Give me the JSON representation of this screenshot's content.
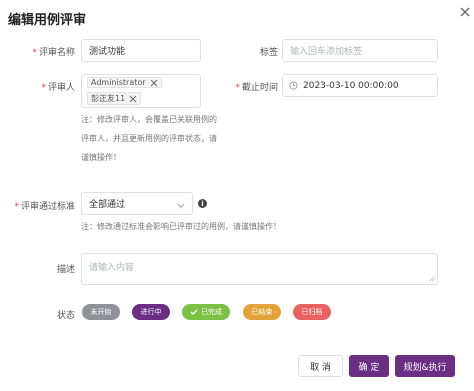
{
  "dialog": {
    "title": "编辑用例评审"
  },
  "form": {
    "name": {
      "label": "评审名称",
      "value": "测试功能"
    },
    "tags": {
      "label": "标签",
      "placeholder": "输入回车添加标签"
    },
    "reviewers": {
      "label": "评审人",
      "selected": [
        "Administrator",
        "彭正友11"
      ]
    },
    "deadline": {
      "label": "截止时间",
      "value": "2023-03-10 00:00:00"
    },
    "reviewers_note": {
      "line1": "注：修改评审人，会覆盖已关联用例的",
      "line2": "评审人，并且更新用例的评审状态，请",
      "line3": "谨慎操作！"
    },
    "criteria": {
      "label": "评审通过标准",
      "value": "全部通过",
      "note": "注：修改通过标准会影响已评审过的用例，请谨慎操作！"
    },
    "description": {
      "label": "描述",
      "placeholder": "请输入内容"
    },
    "status": {
      "label": "状态",
      "options": [
        {
          "label": "未开始",
          "color": "#8e9197"
        },
        {
          "label": "进行中",
          "color": "#6b2e83"
        },
        {
          "label": "已完成",
          "color": "#7cc242"
        },
        {
          "label": "已结束",
          "color": "#e4a33a"
        },
        {
          "label": "已归档",
          "color": "#e8625f"
        }
      ]
    }
  },
  "footer": {
    "cancel": "取 消",
    "confirm": "确 定",
    "plan_execute": "规划&执行"
  },
  "colors": {
    "primary": "#6b2e83",
    "required": "#e04646",
    "border": "#dcdfe6"
  }
}
